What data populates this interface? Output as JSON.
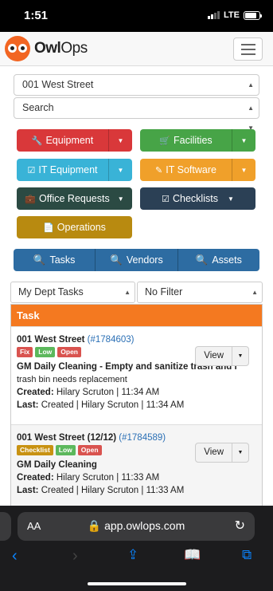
{
  "status": {
    "time": "1:51",
    "network": "LTE"
  },
  "header": {
    "brand_owl": "Owl",
    "brand_ops": "Ops"
  },
  "location_select": "001 West Street",
  "search_select": "Search",
  "categories": [
    {
      "label": "Equipment",
      "color": "#d9383a"
    },
    {
      "label": "Facilities",
      "color": "#47a447"
    },
    {
      "label": "IT Equipment",
      "color": "#39b3d7"
    },
    {
      "label": "IT Software",
      "color": "#f0a02a"
    },
    {
      "label": "Office Requests",
      "color": "#2b4a43"
    },
    {
      "label": "Checklists",
      "color": "#2b4055"
    },
    {
      "label": "Operations",
      "color": "#b88a10"
    }
  ],
  "tabs": [
    "Tasks",
    "Vendors",
    "Assets"
  ],
  "filters": {
    "dept": "My Dept Tasks",
    "filter": "No Filter"
  },
  "panel": {
    "heading": "Task"
  },
  "tasks": [
    {
      "location": "001 West Street",
      "number": "(#1784603)",
      "badges": [
        "Fix",
        "Low",
        "Open"
      ],
      "name": "GM Daily Cleaning - Empty and sanitize trash and r",
      "description": "trash bin needs replacement",
      "created_label": "Created:",
      "created": "Hilary Scruton | 11:34 AM",
      "last_label": "Last:",
      "last": "Created | Hilary Scruton | 11:34 AM",
      "view_label": "View"
    },
    {
      "location": "001 West Street (12/12)",
      "number": "(#1784589)",
      "badges": [
        "Checklist",
        "Low",
        "Open"
      ],
      "name": "GM Daily Cleaning",
      "description": "",
      "created_label": "Created:",
      "created": "Hilary Scruton | 11:33 AM",
      "last_label": "Last:",
      "last": "Created | Hilary Scruton | 11:33 AM",
      "view_label": "View"
    }
  ],
  "browser": {
    "aa": "AA",
    "url": "app.owlops.com"
  }
}
